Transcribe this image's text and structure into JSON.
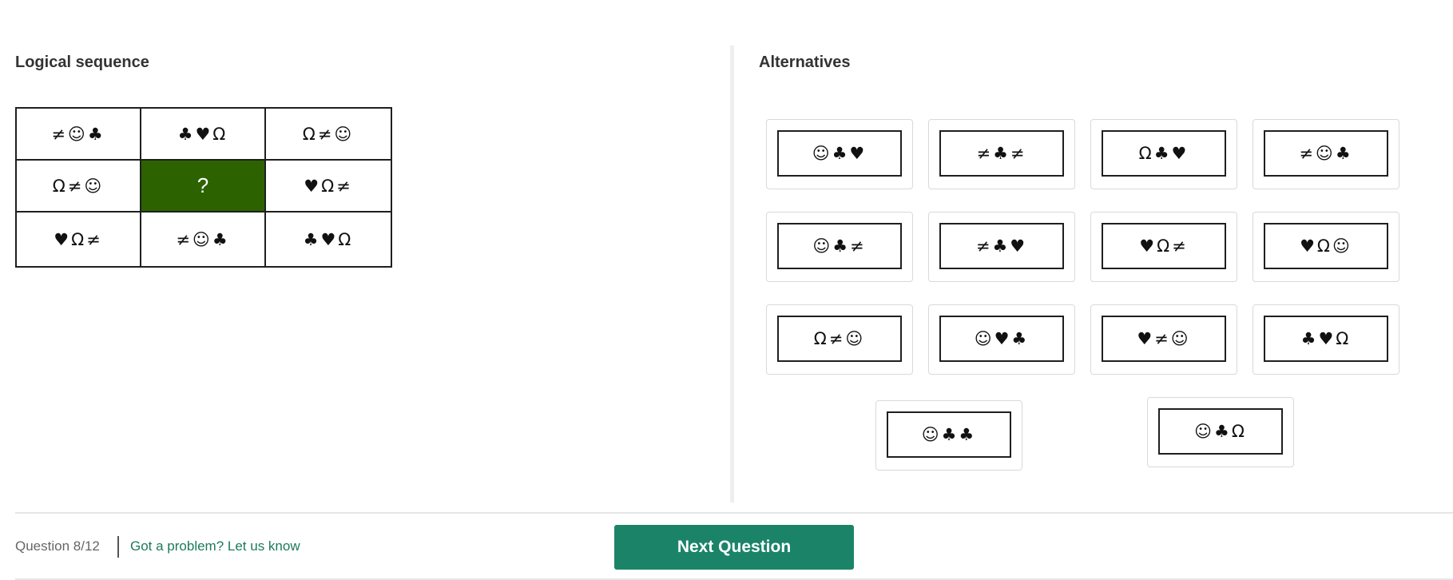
{
  "left": {
    "title": "Logical sequence",
    "matrix": [
      "≠☺♣",
      "♣♥Ω",
      "Ω≠☺",
      "Ω≠☺",
      "?",
      "♥Ω≠",
      "♥Ω≠",
      "≠☺♣",
      "♣♥Ω"
    ],
    "missing_cell_color": "#2d6200"
  },
  "right": {
    "title": "Alternatives",
    "options": [
      "☺♣♥",
      "≠♣≠",
      "Ω♣♥",
      "≠☺♣",
      "☺♣≠",
      "≠♣♥",
      "♥Ω≠",
      "♥Ω☺",
      "Ω≠☺",
      "☺♥♣",
      "♥≠☺",
      "♣♥Ω",
      "☺♣♣",
      "☺♣Ω"
    ]
  },
  "footer": {
    "question_counter": "Question 8/12",
    "problem_link": "Got a problem? Let us know",
    "next_button": "Next Question",
    "accent_color": "#1b8468"
  }
}
